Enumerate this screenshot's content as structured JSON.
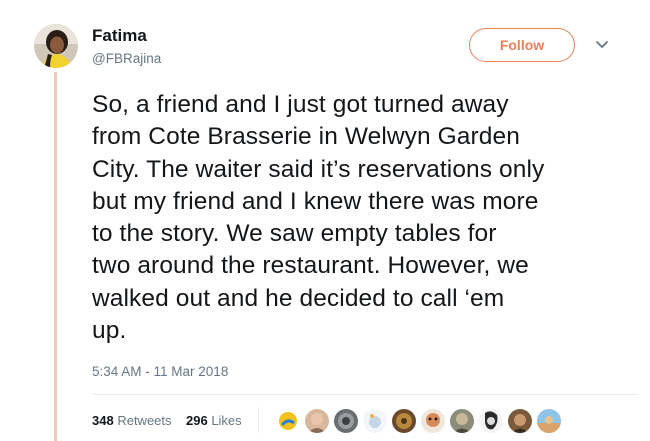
{
  "tweet": {
    "author_name": "Fatima",
    "author_handle": "@FBRajina",
    "follow_label": "Follow",
    "text": "So, a friend and I just got turned away\nfrom Cote Brasserie in Welwyn Garden\nCity. The waiter said it’s reservations only\nbut my friend and I knew there was more\nto the story. We saw empty tables for\ntwo around the restaurant. However, we\nwalked out and he decided to call ‘em\nup.",
    "timestamp": "5:34 AM - 11 Mar 2018",
    "retweets_count": "348",
    "retweets_label": "Retweets",
    "likes_count": "296",
    "likes_label": "Likes"
  },
  "icons": {
    "options": "chevron-down-icon",
    "avatar": "profile-avatar",
    "likers": "liker-avatar"
  },
  "colors": {
    "accent": "#e8815a",
    "rule": "#f2c9b6",
    "muted": "#657786",
    "text": "#14171a"
  }
}
